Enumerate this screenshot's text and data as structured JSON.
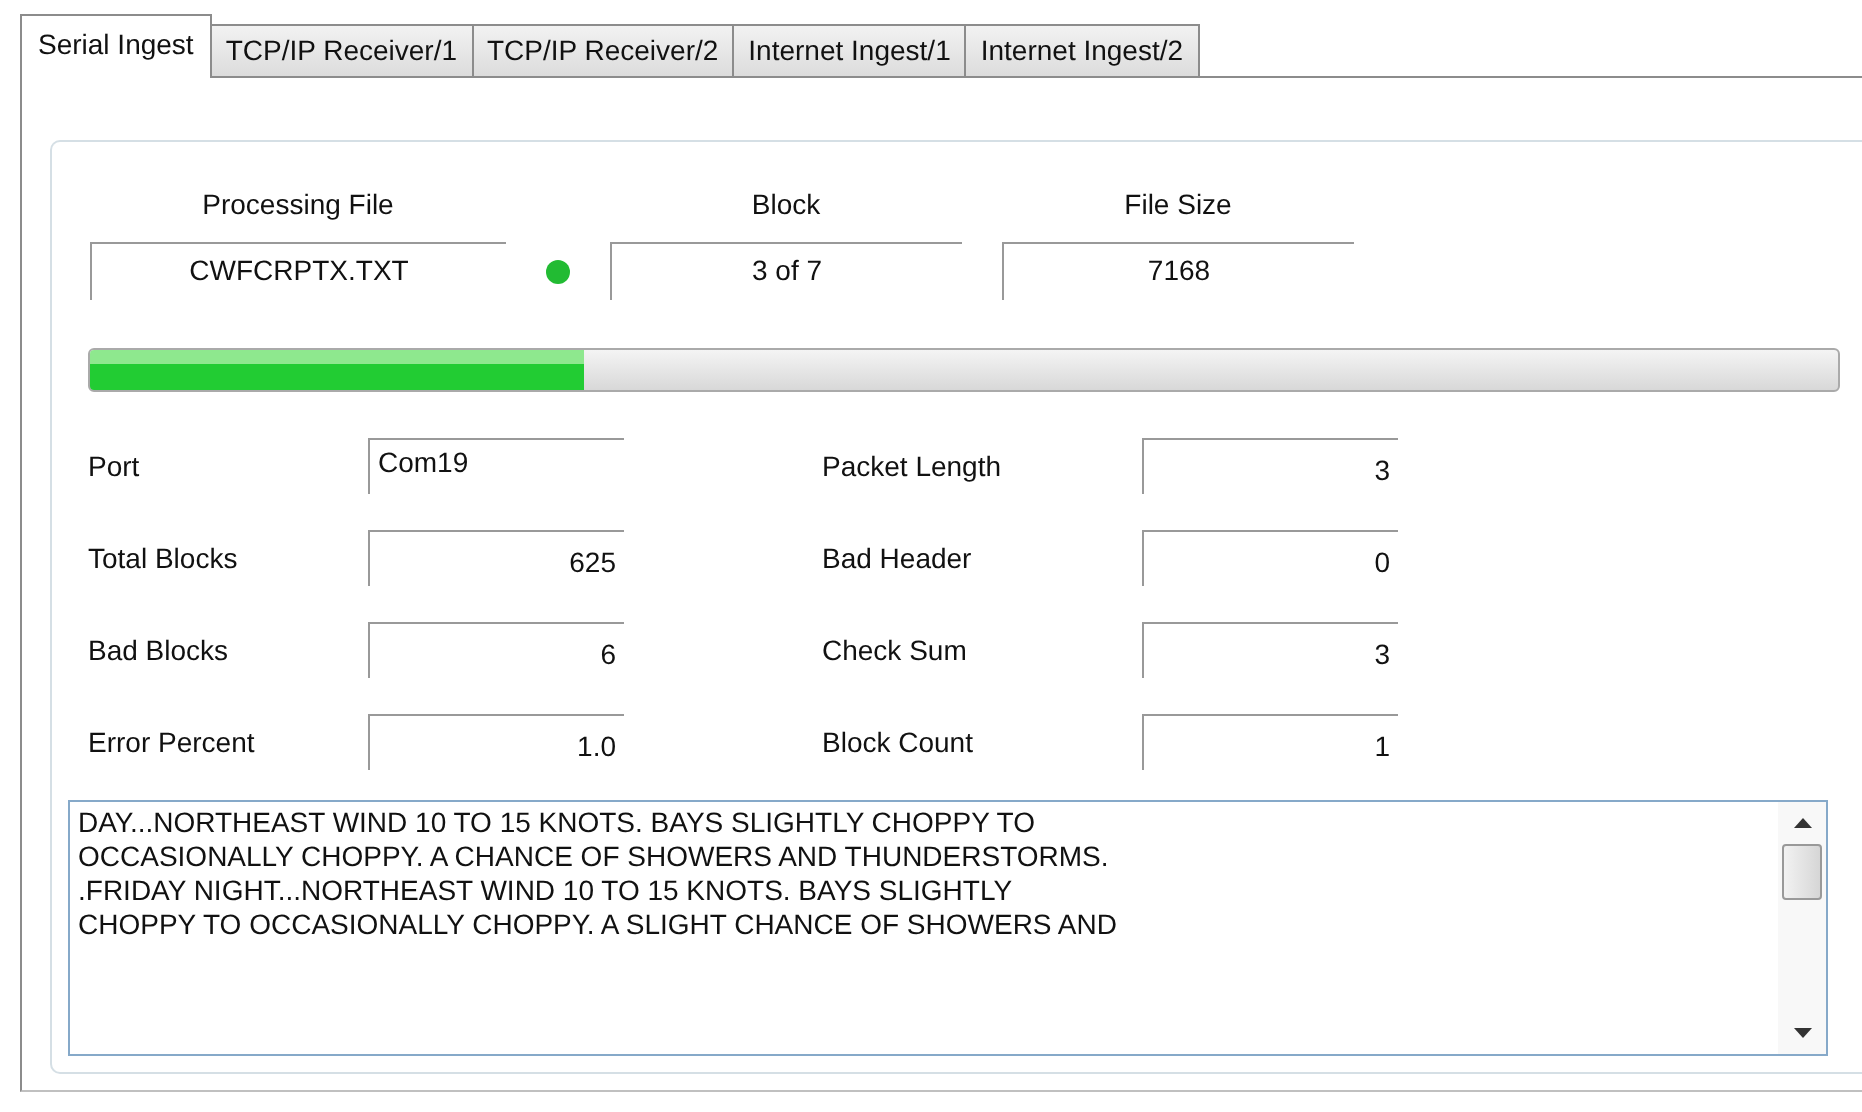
{
  "tabs": [
    {
      "label": "Serial Ingest",
      "selected": true
    },
    {
      "label": "TCP/IP Receiver/1",
      "selected": false
    },
    {
      "label": "TCP/IP Receiver/2",
      "selected": false
    },
    {
      "label": "Internet Ingest/1",
      "selected": false
    },
    {
      "label": "Internet Ingest/2",
      "selected": false
    }
  ],
  "status": {
    "columns": [
      {
        "heading": "Processing File",
        "value": "CWFCRPTX.TXT",
        "indicator": {
          "on": true,
          "color": "#22bb33"
        }
      },
      {
        "heading": "Block",
        "value": "3 of 7"
      },
      {
        "heading": "File Size",
        "value": "7168"
      }
    ],
    "progress": {
      "level": 0.283
    }
  },
  "fields_left": [
    {
      "label": "Port",
      "value": "Com19",
      "kind": "text"
    },
    {
      "label": "Total Blocks",
      "value": "625",
      "kind": "number"
    },
    {
      "label": "Bad Blocks",
      "value": "6",
      "kind": "number"
    },
    {
      "label": "Error Percent",
      "value": "1.0",
      "kind": "number"
    }
  ],
  "fields_right": [
    {
      "label": "Packet Length",
      "value": "3",
      "kind": "number"
    },
    {
      "label": "Bad Header",
      "value": "0",
      "kind": "number"
    },
    {
      "label": "Check Sum",
      "value": "3",
      "kind": "number"
    },
    {
      "label": "Block Count",
      "value": "1",
      "kind": "number"
    }
  ],
  "log_text": "DAY...NORTHEAST WIND 10 TO 15 KNOTS. BAYS SLIGHTLY CHOPPY TO\nOCCASIONALLY CHOPPY. A CHANCE OF SHOWERS AND THUNDERSTORMS.\n.FRIDAY NIGHT...NORTHEAST WIND 10 TO 15 KNOTS. BAYS SLIGHTLY\nCHOPPY TO OCCASIONALLY CHOPPY. A SLIGHT CHANCE OF SHOWERS AND"
}
